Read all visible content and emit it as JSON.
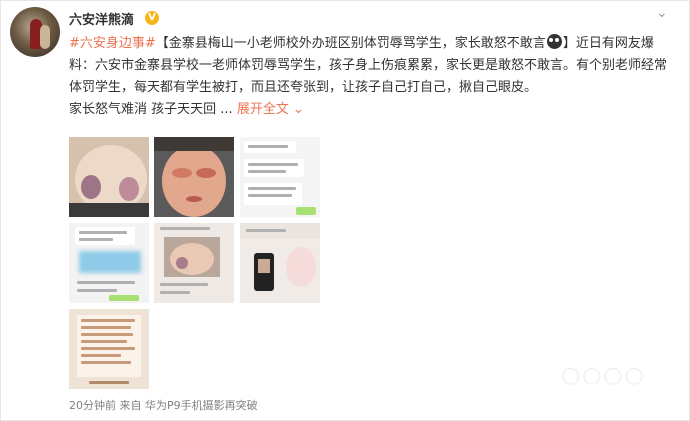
{
  "user": {
    "name": "六安洋熊滴",
    "verified_badge": "V"
  },
  "post": {
    "hashtag": "#六安身边事#",
    "title": "【金寨县梅山一小老师校外办班区别体罚辱骂学生，家长敢怒不敢言",
    "title_end": "】",
    "body1": "近日有网友爆料：六安市金寨县学校一老师体罚辱骂学生，孩子身上伤痕累累，家长更是敢怒不敢言。有个别老师经常体罚学生，每天都有学生被打，而且还夸张到，让孩子自己打自己，揪自己眼皮。",
    "body2": "家长怒气难消 孩子天天回 ...",
    "expand_label": "展开全文",
    "expand_icon": "chevron-down-icon"
  },
  "footer": {
    "time": "20分钟前",
    "source_prefix": "来自",
    "source": "华为P9手机摄影再突破"
  },
  "colors": {
    "link": "#eb7350",
    "text": "#333333",
    "muted": "#808080",
    "badge": "#f6b71b"
  }
}
